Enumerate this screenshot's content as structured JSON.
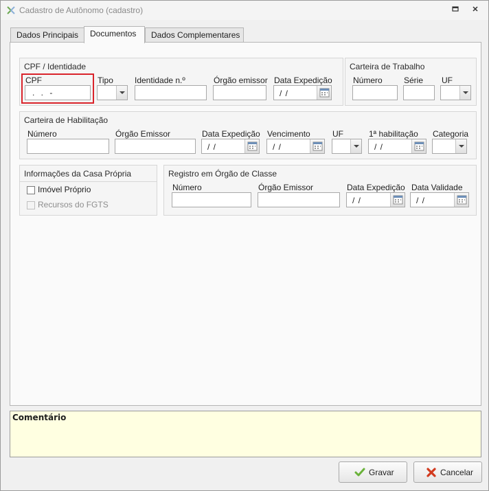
{
  "window": {
    "title": "Cadastro de Autônomo (cadastro)"
  },
  "tabs": [
    {
      "label": "Dados Principais"
    },
    {
      "label": "Documentos"
    },
    {
      "label": "Dados Complementares"
    }
  ],
  "cpf_identidade": {
    "title": "CPF / Identidade",
    "cpf_label": "CPF",
    "cpf_value": ". . -",
    "tipo_label": "Tipo",
    "identidade_label": "Identidade n.º",
    "orgao_label": "Órgão emissor",
    "data_label": "Data Expedição",
    "data_value": "/ /"
  },
  "carteira_trabalho": {
    "title": "Carteira de Trabalho",
    "numero_label": "Número",
    "serie_label": "Série",
    "uf_label": "UF"
  },
  "carteira_habilitacao": {
    "title": "Carteira de Habilitação",
    "numero_label": "Número",
    "orgao_label": "Órgão Emissor",
    "data_label": "Data Expedição",
    "data_value": "/ /",
    "vencimento_label": "Vencimento",
    "vencimento_value": "/ /",
    "uf_label": "UF",
    "primeira_label": "1ª habilitação",
    "primeira_value": "/ /",
    "categoria_label": "Categoria"
  },
  "casa_propria": {
    "title": "Informações da Casa Própria",
    "imovel_label": "Imóvel Próprio",
    "fgts_label": "Recursos do FGTS"
  },
  "registro_classe": {
    "title": "Registro em Órgão de Classe",
    "numero_label": "Número",
    "orgao_label": "Órgão Emissor",
    "data_label": "Data Expedição",
    "data_value": "/ /",
    "validade_label": "Data Validade",
    "validade_value": "/ /"
  },
  "comment": {
    "label": "Comentário"
  },
  "buttons": {
    "save": "Gravar",
    "cancel": "Cancelar"
  }
}
